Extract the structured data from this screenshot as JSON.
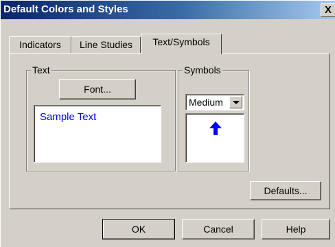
{
  "window": {
    "title": "Default Colors and Styles",
    "close_glyph": "X"
  },
  "tabs": [
    {
      "label": "Indicators",
      "active": false
    },
    {
      "label": "Line Studies",
      "active": false
    },
    {
      "label": "Text/Symbols",
      "active": true
    }
  ],
  "text_group": {
    "label": "Text",
    "font_button": "Font...",
    "sample_text": "Sample Text",
    "sample_color": "#0000ff"
  },
  "symbols_group": {
    "label": "Symbols",
    "size_selected": "Medium",
    "preview_icon": "up-arrow-icon",
    "preview_color": "#0000ff"
  },
  "buttons": {
    "defaults": "Defaults...",
    "ok": "OK",
    "cancel": "Cancel",
    "help": "Help"
  },
  "colors": {
    "face": "#d4d0c8",
    "title_start": "#0a246a",
    "title_end": "#a6caf0"
  }
}
